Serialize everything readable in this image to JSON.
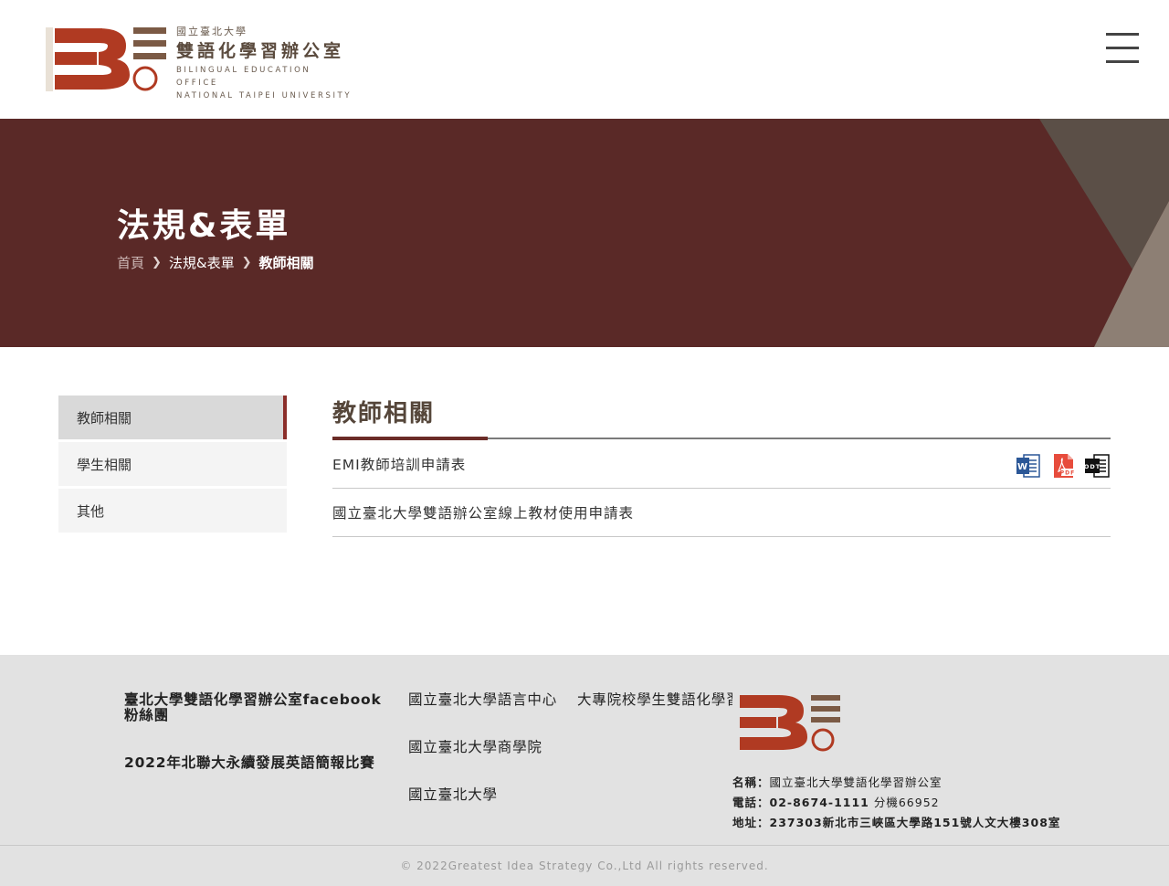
{
  "header": {
    "logo": {
      "univ_small": "國立臺北大學",
      "office_name": "雙語化學習辦公室",
      "en_line1": "BILINGUAL EDUCATION OFFICE",
      "en_line2": "NATIONAL TAIPEI UNIVERSITY"
    },
    "menu_icon": "hamburger-menu-icon"
  },
  "banner": {
    "title": "法規&表單",
    "breadcrumb": {
      "home": "首頁",
      "section": "法規&表單",
      "current": "教師相關"
    }
  },
  "sidebar": {
    "items": [
      {
        "label": "教師相關",
        "active": true
      },
      {
        "label": "學生相關",
        "active": false
      },
      {
        "label": "其他",
        "active": false
      }
    ]
  },
  "main": {
    "title": "教師相關",
    "documents": [
      {
        "name": "EMI教師培訓申請表",
        "files": [
          "word-icon",
          "pdf-icon",
          "odt-icon"
        ]
      },
      {
        "name": "國立臺北大學雙語辦公室線上教材使用申請表",
        "files": []
      }
    ]
  },
  "footer": {
    "col1": [
      "臺北大學雙語化學習辦公室facebook粉絲團",
      "2022年北聯大永續發展英語簡報比賽"
    ],
    "col2": [
      "國立臺北大學語言中心",
      "國立臺北大學商學院",
      "國立臺北大學"
    ],
    "col3": [
      "大專院校學生雙語化學習計畫"
    ],
    "info": {
      "name_label": "名稱：",
      "name_value": "國立臺北大學雙語化學習辦公室",
      "phone_label": "電話：",
      "phone_value": "02-8674-1111",
      "phone_ext": "分機66952",
      "address_label": "地址：",
      "address_value": "237303新北市三峽區大學路151號人文大樓308室"
    },
    "copyright": "© 2022Greatest Idea Strategy Co.,Ltd All rights reserved."
  },
  "colors": {
    "brand_red": "#b03a22",
    "banner_bg": "#5a2927",
    "logo_brown": "#7b5a45",
    "sidebar_accent": "#8b2e2a"
  }
}
